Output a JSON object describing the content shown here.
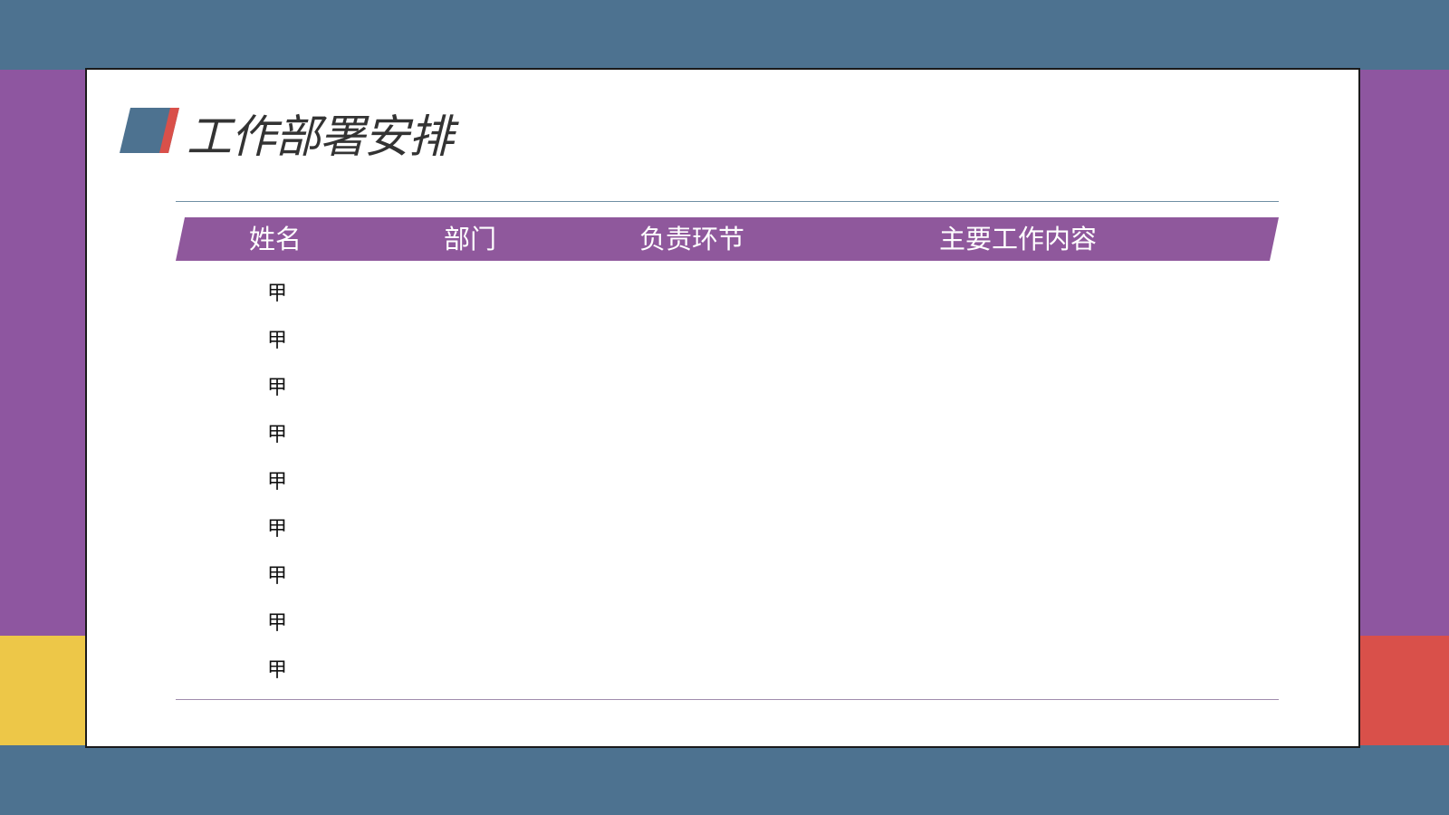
{
  "slide": {
    "title": "工作部署安排"
  },
  "colors": {
    "background_blue": "#4d7290",
    "purple": "#8e56a0",
    "yellow": "#edc748",
    "red": "#d9504a",
    "header_purple": "#8f589c"
  },
  "table": {
    "headers": [
      "姓名",
      "部门",
      "负责环节",
      "主要工作内容"
    ],
    "rows": [
      [
        "甲",
        "",
        "",
        ""
      ],
      [
        "甲",
        "",
        "",
        ""
      ],
      [
        "甲",
        "",
        "",
        ""
      ],
      [
        "甲",
        "",
        "",
        ""
      ],
      [
        "甲",
        "",
        "",
        ""
      ],
      [
        "甲",
        "",
        "",
        ""
      ],
      [
        "甲",
        "",
        "",
        ""
      ],
      [
        "甲",
        "",
        "",
        ""
      ],
      [
        "甲",
        "",
        "",
        ""
      ]
    ]
  }
}
